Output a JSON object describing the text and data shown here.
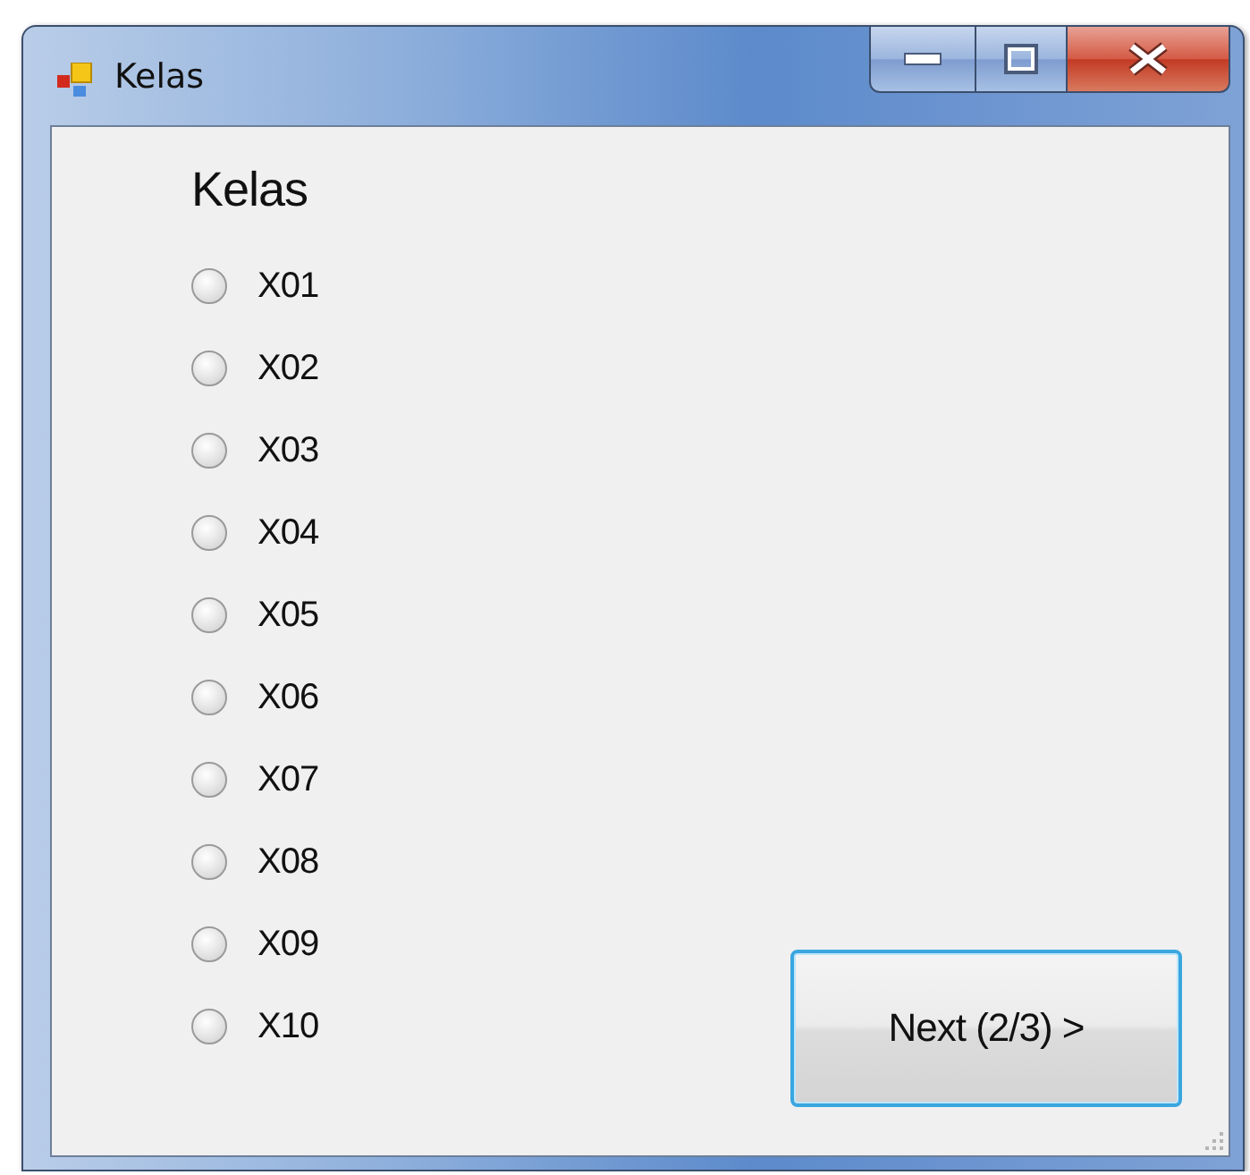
{
  "window": {
    "title": "Kelas"
  },
  "heading": "Kelas",
  "options": [
    {
      "label": "X01",
      "selected": false
    },
    {
      "label": "X02",
      "selected": false
    },
    {
      "label": "X03",
      "selected": false
    },
    {
      "label": "X04",
      "selected": false
    },
    {
      "label": "X05",
      "selected": false
    },
    {
      "label": "X06",
      "selected": false
    },
    {
      "label": "X07",
      "selected": false
    },
    {
      "label": "X08",
      "selected": false
    },
    {
      "label": "X09",
      "selected": false
    },
    {
      "label": "X10",
      "selected": false
    }
  ],
  "next_button": {
    "label": "Next (2/3) >"
  }
}
